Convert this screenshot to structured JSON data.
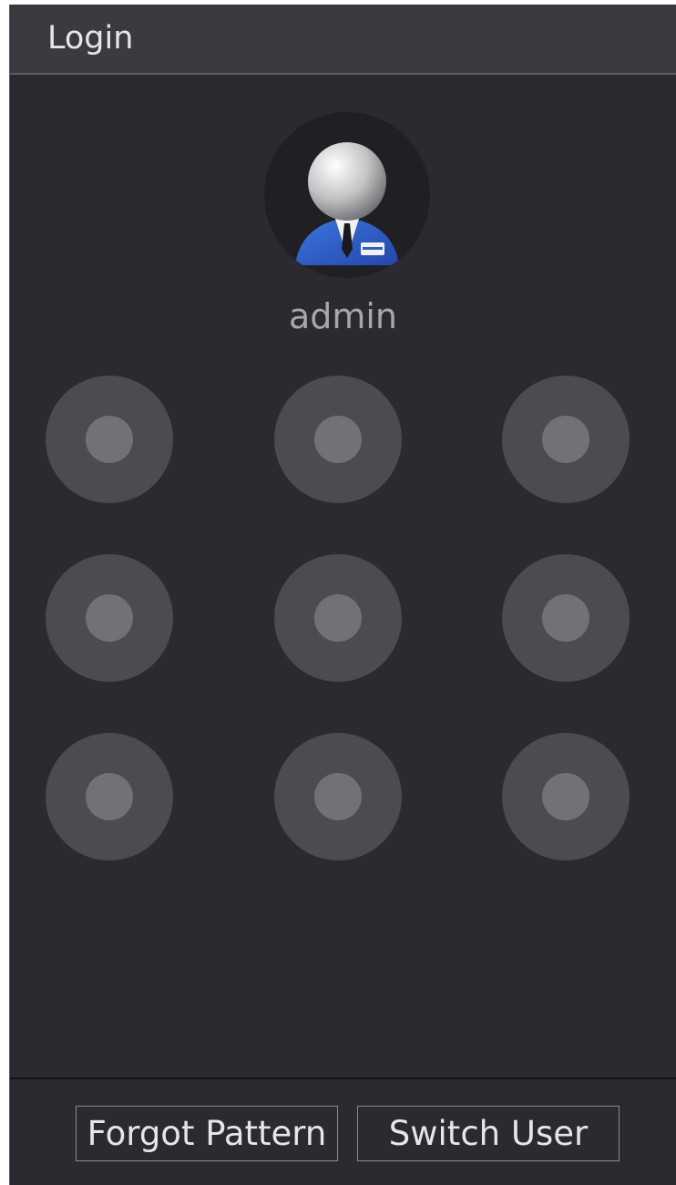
{
  "window": {
    "title": "Login"
  },
  "user": {
    "name": "admin",
    "avatar_icon": "user-avatar-icon"
  },
  "pattern": {
    "nodes": [
      1,
      2,
      3,
      4,
      5,
      6,
      7,
      8,
      9
    ],
    "node_color": "#4b4b50",
    "dot_color": "#717176"
  },
  "footer": {
    "forgot_label": "Forgot Pattern",
    "switch_label": "Switch User"
  },
  "colors": {
    "background": "#2a2a30",
    "titlebar": "#3a3a40",
    "avatar_suit": "#2f5fc4"
  }
}
